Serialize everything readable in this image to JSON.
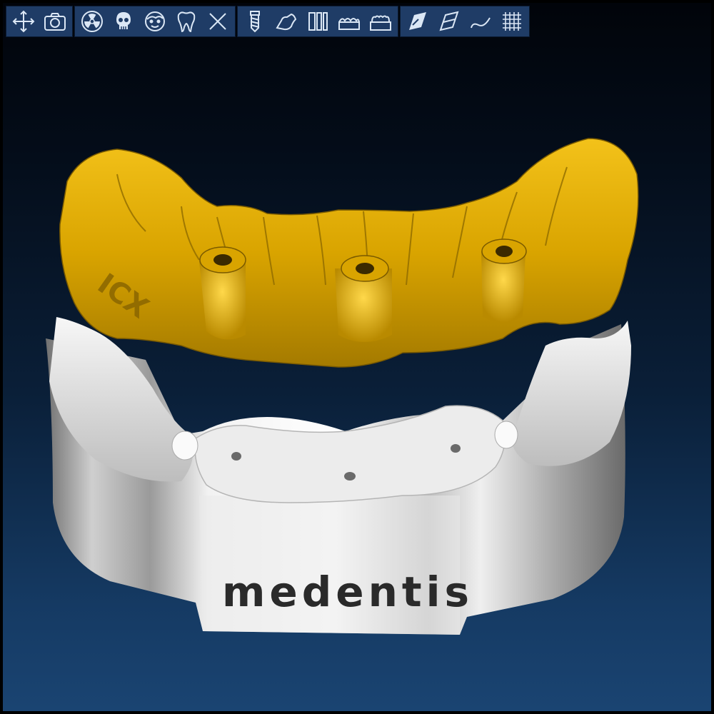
{
  "toolbar": {
    "groups": [
      {
        "name": "view",
        "tools": [
          "pan-icon",
          "camera-icon"
        ]
      },
      {
        "name": "objects",
        "tools": [
          "radiation-icon",
          "skull-icon",
          "face-icon",
          "tooth-icon",
          "close-x-icon"
        ]
      },
      {
        "name": "dental-tools",
        "tools": [
          "implant-screw-icon",
          "bone-icon",
          "implant-pair-icon",
          "gum-model-icon",
          "teeth-model-icon"
        ]
      },
      {
        "name": "view-tools",
        "tools": [
          "slice-plane-icon",
          "plane-icon",
          "curve-icon",
          "grid-icon"
        ]
      }
    ]
  },
  "scene": {
    "guide_engraving": "ICX",
    "base_engraving": "medentis"
  },
  "colors": {
    "toolbar_bg": "#1f3c66",
    "icon": "#dbe7f5",
    "guide": "#e0a800",
    "model": "#e8e8e8"
  }
}
